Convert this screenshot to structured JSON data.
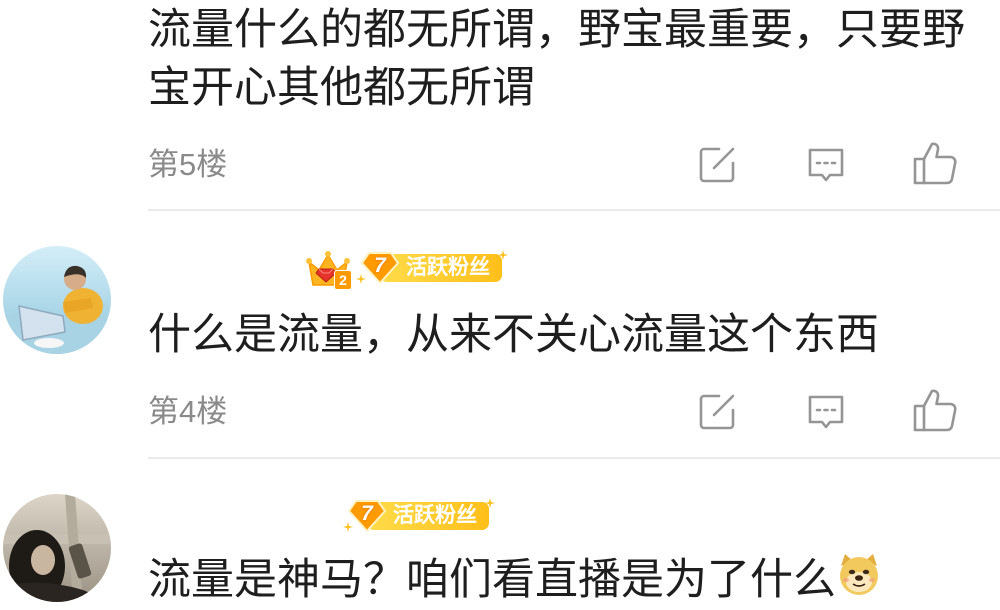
{
  "comments": [
    {
      "text_lines": [
        "流量什么的都无所谓，野宝最重要，只要野",
        "宝开心其他都无所谓"
      ],
      "floor": "第5楼",
      "actions": [
        "share-icon",
        "comment-icon",
        "like-icon"
      ]
    },
    {
      "crown_badge": {
        "icon": "crown-icon",
        "number": "2"
      },
      "fan_badge": {
        "icon": "gem-icon",
        "level": "7",
        "label": "活跃粉丝"
      },
      "text_lines": [
        "什么是流量，从来不关心流量这个东西"
      ],
      "floor": "第4楼",
      "actions": [
        "share-icon",
        "comment-icon",
        "like-icon"
      ]
    },
    {
      "fan_badge": {
        "icon": "gem-icon",
        "level": "7",
        "label": "活跃粉丝"
      },
      "text_lines": [
        "流量是神马？咱们看直播是为了什么"
      ],
      "emoji": "doge-emoji-icon"
    }
  ],
  "colors": {
    "text": "#1e1e1e",
    "meta": "#8a8a8a",
    "icon": "#959595",
    "divider": "#ececec",
    "badge_light": "#ffdc4a",
    "badge_yellow": "#ffbf1a",
    "badge_orange": "#ff9a00",
    "crown_gold": "#ffb422",
    "crown_gem": "#e6332b",
    "background": "#ffffff"
  }
}
